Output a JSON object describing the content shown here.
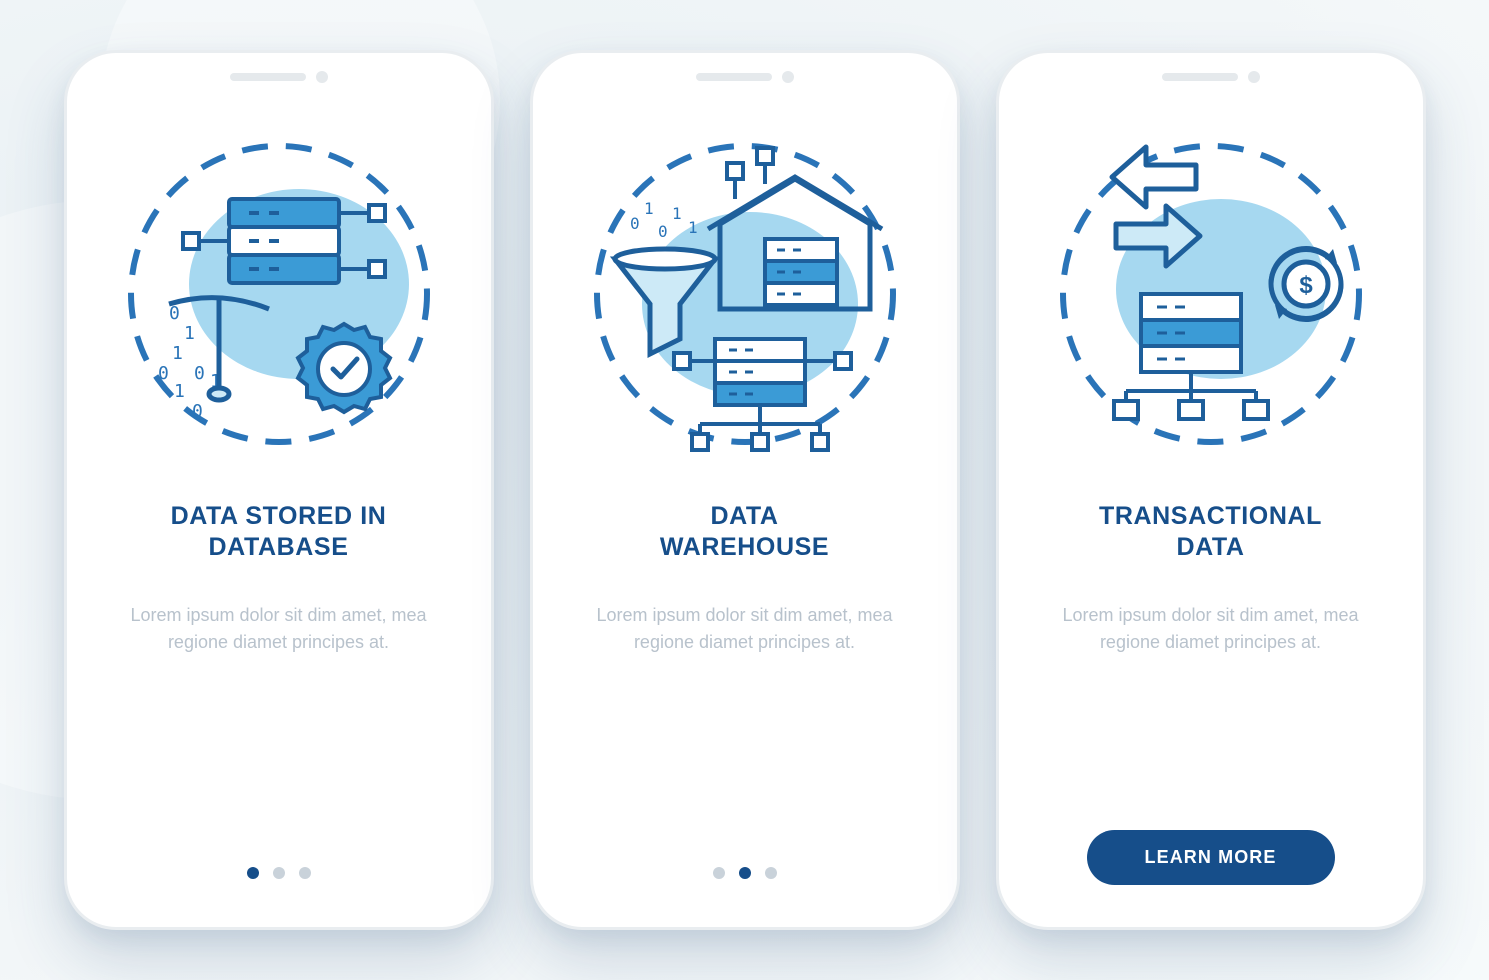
{
  "colors": {
    "primary": "#164e8a",
    "accent_light": "#a6d8f0",
    "icon_stroke": "#2a74b8",
    "muted_text": "#b8c2cc",
    "dot_inactive": "#c9d2da",
    "phone_bg": "#ffffff"
  },
  "screens": [
    {
      "illustration": "database-storage-icon",
      "title": "DATA STORED IN\nDATABASE",
      "description": "Lorem ipsum dolor sit dim amet, mea regione diamet principes at.",
      "footer_type": "dots",
      "active_dot": 0
    },
    {
      "illustration": "data-warehouse-icon",
      "title": "DATA\nWAREHOUSE",
      "description": "Lorem ipsum dolor sit dim amet, mea regione diamet principes at.",
      "footer_type": "dots",
      "active_dot": 1
    },
    {
      "illustration": "transactional-data-icon",
      "title": "TRANSACTIONAL\nDATA",
      "description": "Lorem ipsum dolor sit dim amet, mea regione diamet principes at.",
      "footer_type": "button",
      "button_label": "LEARN MORE"
    }
  ],
  "dot_count": 3
}
